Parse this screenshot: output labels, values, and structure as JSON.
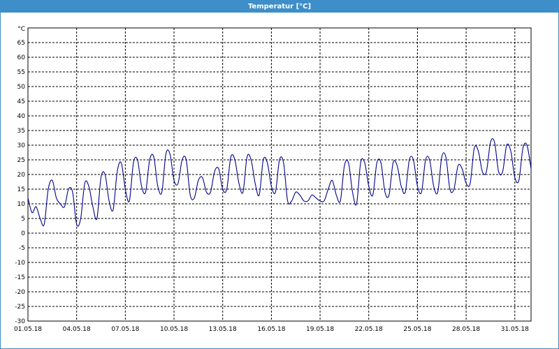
{
  "window": {
    "title": "Temperatur [°C]"
  },
  "chart_data": {
    "type": "line",
    "title": "Temperatur [°C]",
    "ylabel": "°C",
    "xlabel": "",
    "xlim": [
      "01.05.18",
      "01.06.18"
    ],
    "ylim": [
      -30,
      70
    ],
    "grid": true,
    "yticks": [
      -30,
      -25,
      -20,
      -15,
      -10,
      -5,
      0,
      5,
      10,
      15,
      20,
      25,
      30,
      35,
      40,
      45,
      50,
      55,
      60,
      65
    ],
    "xticks": [
      "01.05.18",
      "04.05.18",
      "07.05.18",
      "10.05.18",
      "13.05.18",
      "16.05.18",
      "19.05.18",
      "22.05.18",
      "25.05.18",
      "28.05.18",
      "31.05.18"
    ],
    "line_color": "#00008b",
    "series": [
      {
        "x": [
          "01.05.18 00:00",
          "01.05.18 06:00",
          "01.05.18 12:00",
          "01.05.18 18:00",
          "02.05.18 00:00",
          "02.05.18 06:00",
          "02.05.18 12:00",
          "02.05.18 18:00",
          "03.05.18 00:00",
          "03.05.18 06:00",
          "03.05.18 12:00",
          "03.05.18 18:00",
          "04.05.18 00:00",
          "04.05.18 06:00",
          "04.05.18 12:00",
          "04.05.18 18:00",
          "05.05.18 00:00",
          "05.05.18 06:00",
          "05.05.18 12:00",
          "05.05.18 18:00",
          "06.05.18 00:00",
          "06.05.18 06:00",
          "06.05.18 12:00",
          "06.05.18 18:00",
          "07.05.18 00:00",
          "07.05.18 06:00",
          "07.05.18 12:00",
          "07.05.18 18:00",
          "08.05.18 00:00",
          "08.05.18 06:00",
          "08.05.18 12:00",
          "08.05.18 18:00",
          "09.05.18 00:00",
          "09.05.18 06:00",
          "09.05.18 12:00",
          "09.05.18 18:00",
          "10.05.18 00:00",
          "10.05.18 06:00",
          "10.05.18 12:00",
          "10.05.18 18:00",
          "11.05.18 00:00",
          "11.05.18 06:00",
          "11.05.18 12:00",
          "11.05.18 18:00",
          "12.05.18 00:00",
          "12.05.18 06:00",
          "12.05.18 12:00",
          "12.05.18 18:00",
          "13.05.18 00:00",
          "13.05.18 06:00",
          "13.05.18 12:00",
          "13.05.18 18:00",
          "14.05.18 00:00",
          "14.05.18 06:00",
          "14.05.18 12:00",
          "14.05.18 18:00",
          "15.05.18 00:00",
          "15.05.18 06:00",
          "15.05.18 12:00",
          "15.05.18 18:00",
          "16.05.18 00:00",
          "16.05.18 06:00",
          "16.05.18 12:00",
          "16.05.18 18:00",
          "17.05.18 00:00",
          "17.05.18 06:00",
          "17.05.18 12:00",
          "17.05.18 18:00",
          "18.05.18 00:00",
          "18.05.18 06:00",
          "18.05.18 12:00",
          "18.05.18 18:00",
          "19.05.18 00:00",
          "19.05.18 06:00",
          "19.05.18 12:00",
          "19.05.18 18:00",
          "20.05.18 00:00",
          "20.05.18 06:00",
          "20.05.18 12:00",
          "20.05.18 18:00",
          "21.05.18 00:00",
          "21.05.18 06:00",
          "21.05.18 12:00",
          "21.05.18 18:00",
          "22.05.18 00:00",
          "22.05.18 06:00",
          "22.05.18 12:00",
          "22.05.18 18:00",
          "23.05.18 00:00",
          "23.05.18 06:00",
          "23.05.18 12:00",
          "23.05.18 18:00",
          "24.05.18 00:00",
          "24.05.18 06:00",
          "24.05.18 12:00",
          "24.05.18 18:00",
          "25.05.18 00:00",
          "25.05.18 06:00",
          "25.05.18 12:00",
          "25.05.18 18:00",
          "26.05.18 00:00",
          "26.05.18 06:00",
          "26.05.18 12:00",
          "26.05.18 18:00",
          "27.05.18 00:00",
          "27.05.18 06:00",
          "27.05.18 12:00",
          "27.05.18 18:00",
          "28.05.18 00:00",
          "28.05.18 06:00",
          "28.05.18 12:00",
          "28.05.18 18:00",
          "29.05.18 00:00",
          "29.05.18 06:00",
          "29.05.18 12:00",
          "29.05.18 18:00",
          "30.05.18 00:00",
          "30.05.18 06:00",
          "30.05.18 12:00",
          "30.05.18 18:00",
          "31.05.18 00:00",
          "31.05.18 06:00",
          "31.05.18 12:00",
          "31.05.18 18:00",
          "01.06.18 00:00"
        ],
        "y": [
          12,
          7,
          9,
          5,
          3,
          15,
          18,
          12,
          10,
          9,
          15,
          14,
          3,
          5,
          17,
          16,
          9,
          5,
          19,
          20,
          11,
          8,
          21,
          24,
          15,
          11,
          24,
          25,
          16,
          14,
          25,
          26,
          16,
          14,
          27,
          27,
          18,
          17,
          25,
          25,
          13,
          12,
          18,
          19,
          14,
          14,
          21,
          22,
          15,
          15,
          26,
          25,
          17,
          14,
          26,
          25,
          17,
          13,
          25,
          24,
          16,
          14,
          25,
          24,
          11,
          11,
          14,
          13,
          11,
          11,
          13,
          12,
          11,
          11,
          15,
          18,
          13,
          11,
          23,
          24,
          14,
          10,
          24,
          24,
          16,
          13,
          24,
          24,
          14,
          13,
          24,
          23,
          16,
          14,
          25,
          25,
          16,
          14,
          25,
          25,
          16,
          14,
          26,
          26,
          15,
          15,
          23,
          22,
          17,
          17,
          29,
          28,
          21,
          21,
          31,
          31,
          21,
          21,
          30,
          28,
          19,
          18,
          29,
          30,
          22
        ]
      }
    ]
  }
}
